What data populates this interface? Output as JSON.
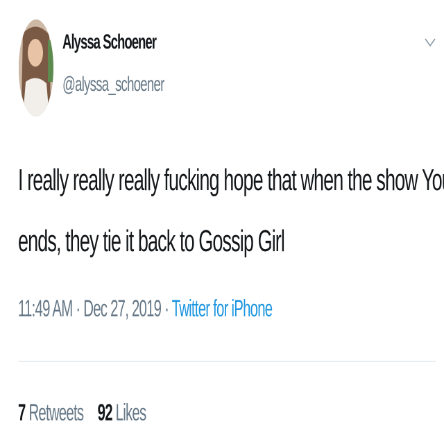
{
  "user": {
    "name": "Alyssa Schoener",
    "handle": "@alyssa_schoener"
  },
  "tweet": {
    "lines": [
      "I really really really fucking hope that when the show You",
      "ends, they tie it back to Gossip Girl"
    ],
    "time": "11:49 AM",
    "separator": " · ",
    "date": "Dec 27, 2019",
    "source": "Twitter for iPhone"
  },
  "stats": {
    "retweets_count": "7",
    "retweets_label": " Retweets",
    "likes_count": "92",
    "likes_label": " Likes"
  },
  "icons": {
    "menu": "chevron-down-icon"
  },
  "colors": {
    "text": "#14171a",
    "secondary": "#657786",
    "link": "#1b95e0",
    "divider": "#e6ecf0"
  }
}
